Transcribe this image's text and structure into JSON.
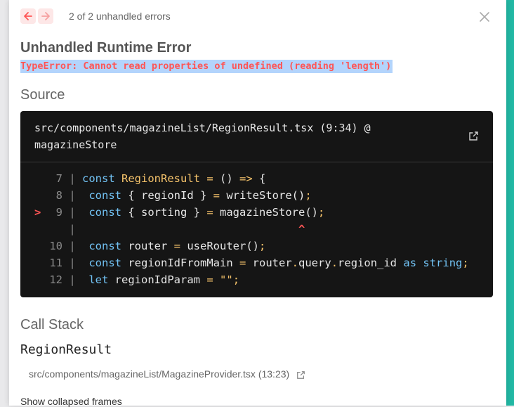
{
  "colors": {
    "accent": "#22b8a4",
    "error": "#ff5555",
    "selection": "#b3d4fc"
  },
  "header": {
    "error_count": "2 of 2 unhandled errors",
    "prev_icon": "arrow-left-icon",
    "next_icon": "arrow-right-icon",
    "close_icon": "close-icon"
  },
  "error": {
    "title": "Unhandled Runtime Error",
    "message": "TypeError: Cannot read properties of undefined (reading 'length')"
  },
  "source": {
    "heading": "Source",
    "file_line1": "src/components/magazineList/RegionResult.tsx (9:34) @",
    "file_line2": "magazineStore",
    "open_icon": "external-link-icon",
    "lines": [
      {
        "num": "7",
        "marker": "",
        "code": "const RegionResult = () => {"
      },
      {
        "num": "8",
        "marker": "",
        "code": " const { regionId } = writeStore();"
      },
      {
        "num": "9",
        "marker": ">",
        "code": " const { sorting } = magazineStore();"
      },
      {
        "num": "",
        "marker": "",
        "code": "                                 ^"
      },
      {
        "num": "10",
        "marker": "",
        "code": " const router = useRouter();"
      },
      {
        "num": "11",
        "marker": "",
        "code": " const regionIdFromMain = router.query.region_id as string;"
      },
      {
        "num": "12",
        "marker": "",
        "code": " let regionIdParam = \"\";"
      }
    ]
  },
  "call_stack": {
    "heading": "Call Stack",
    "frame_function": "RegionResult",
    "frame_file": "src/components/magazineList/MagazineProvider.tsx (13:23)",
    "show_collapsed": "Show collapsed frames"
  }
}
